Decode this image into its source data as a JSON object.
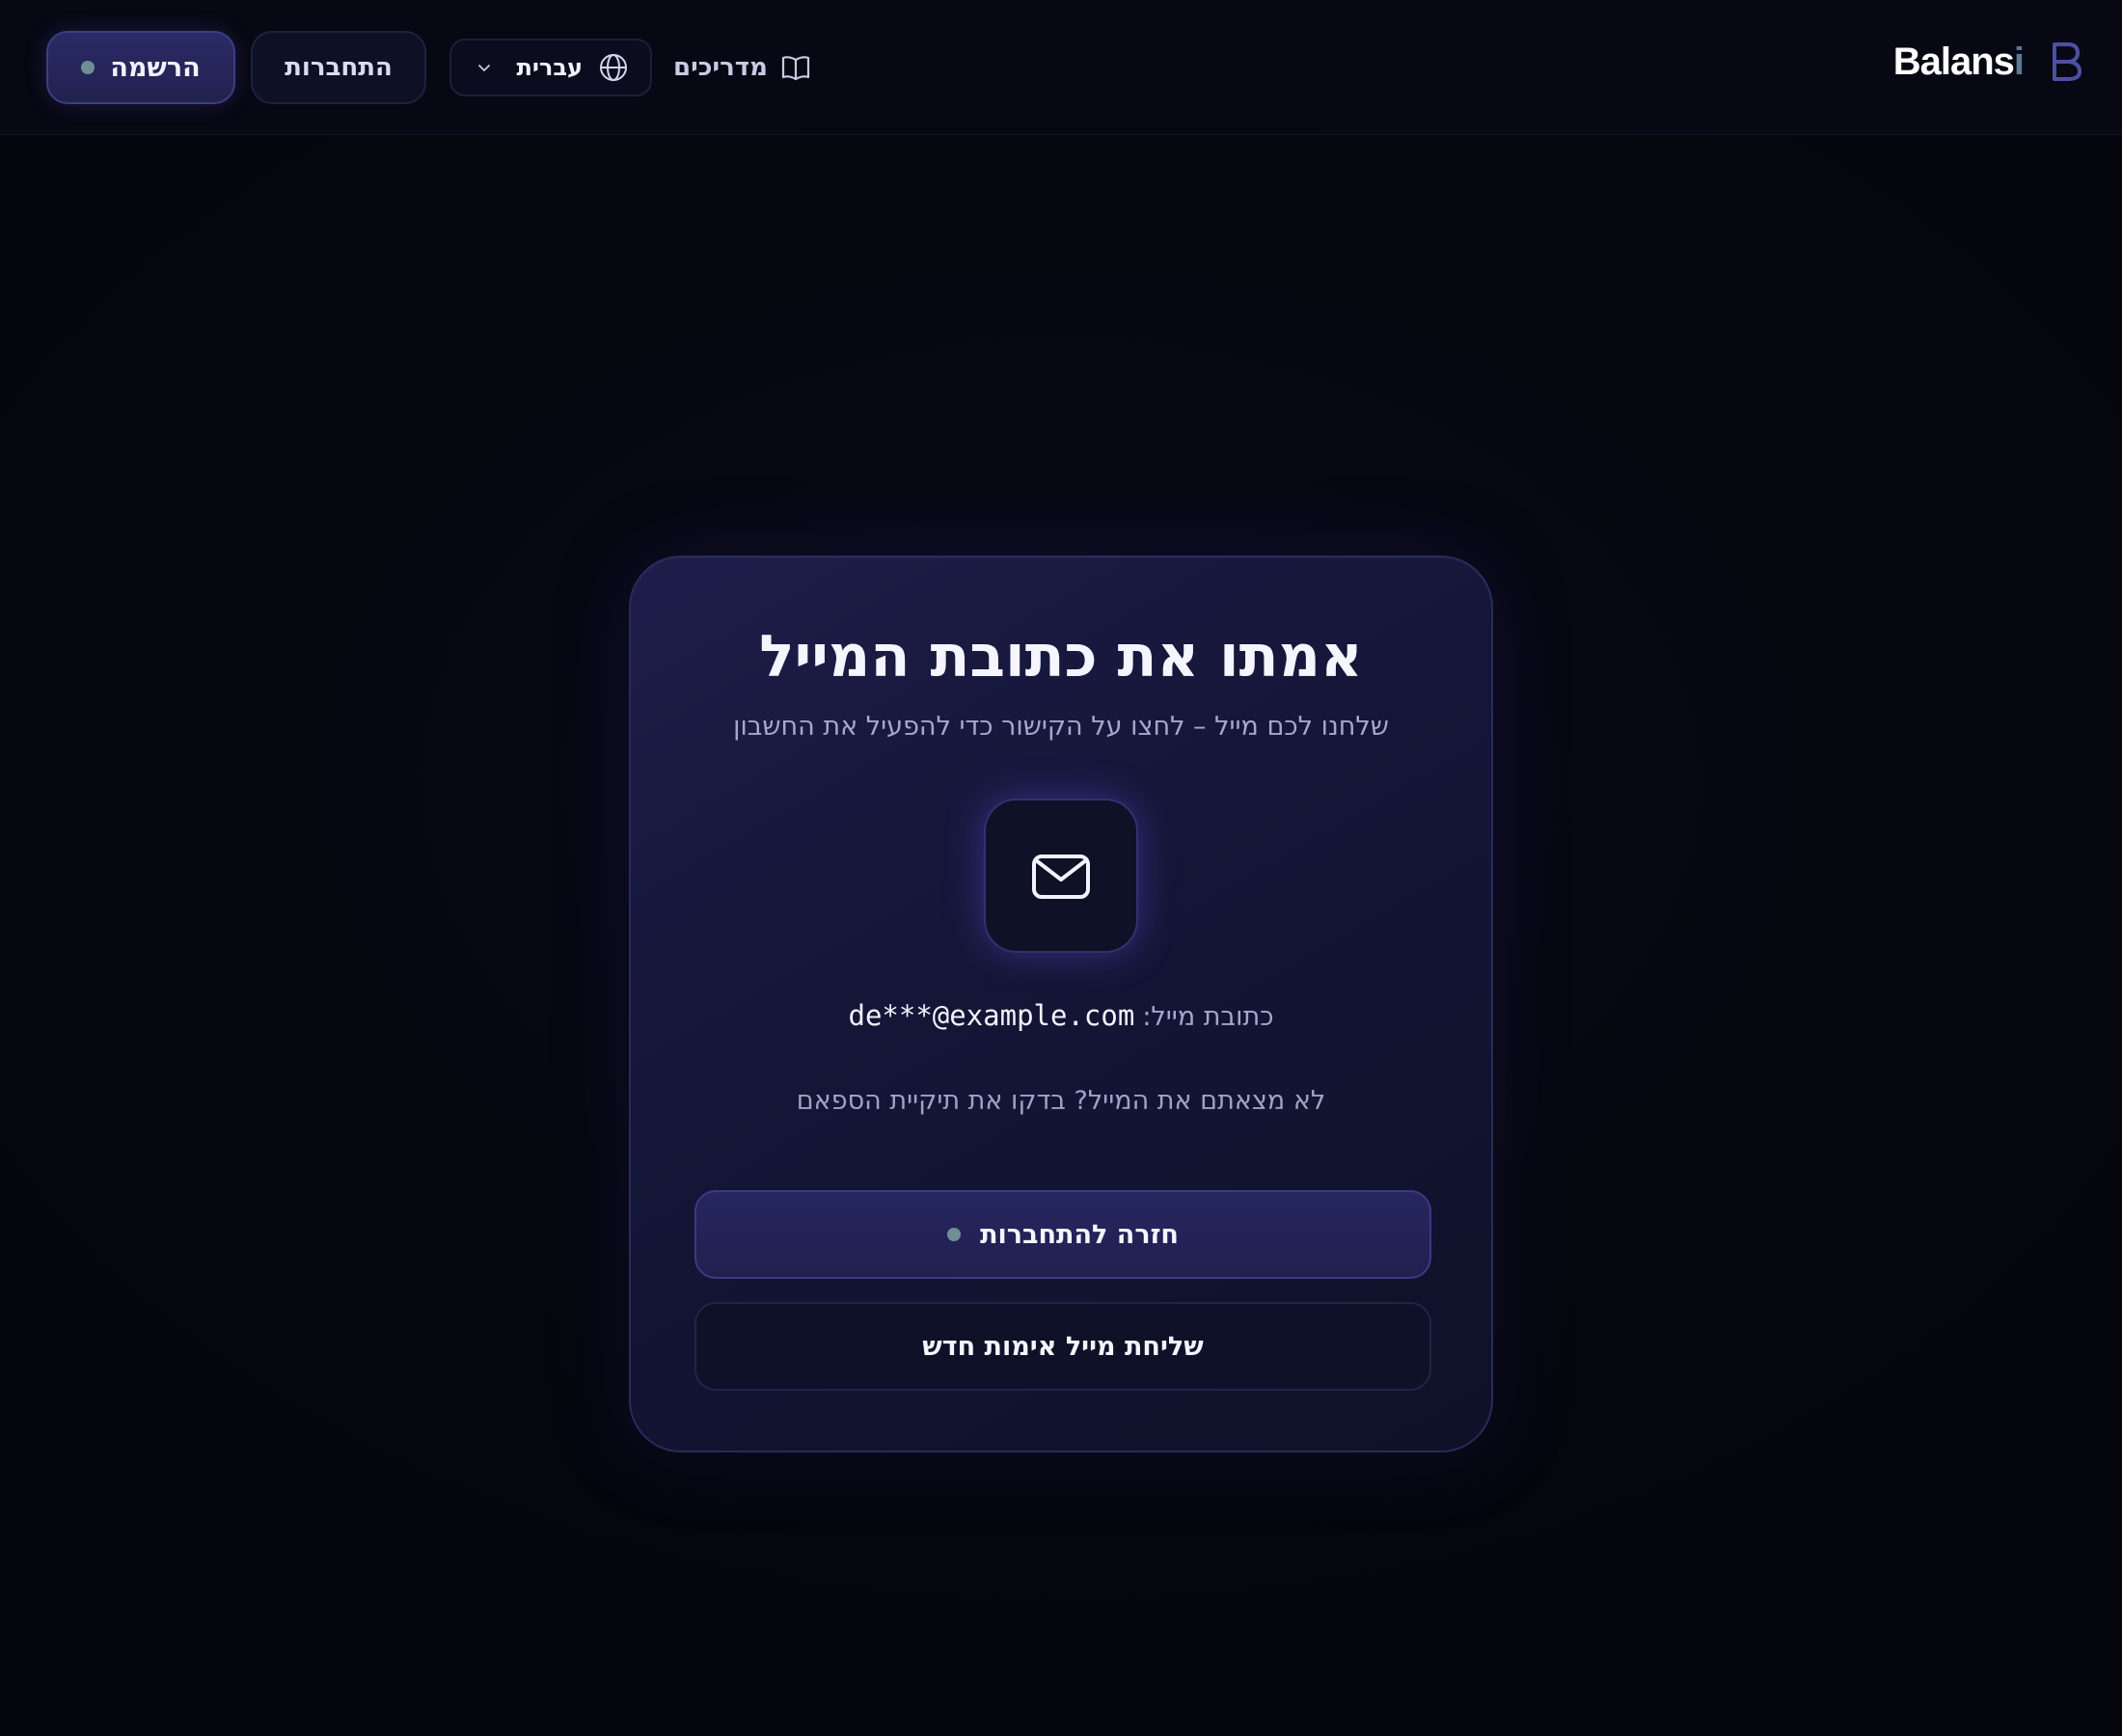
{
  "header": {
    "logo": {
      "text_main": "Balans",
      "text_accent": "i",
      "mark_icon": "b-logo-icon"
    },
    "guides_label": "מדריכים",
    "guides_icon": "book-icon",
    "language": {
      "selected": "עברית",
      "icon": "globe-icon"
    },
    "login_label": "התחברות",
    "signup_label": "הרשמה"
  },
  "card": {
    "title": "אמתו את כתובת המייל",
    "subtitle": "שלחנו לכם מייל – לחצו על הקישור כדי להפעיל את החשבון",
    "icon": "mail-icon",
    "email_label": "כתובת מייל:",
    "email_value": "de***@example.com",
    "spam_note": "לא מצאתם את המייל? בדקו את תיקיית הספאם",
    "back_button": "חזרה להתחברות",
    "resend_button": "שליחת מייל אימות חדש"
  },
  "colors": {
    "background": "#05060f",
    "card": "#151638",
    "accent_button": "#242458",
    "dot": "#6f8f95",
    "logo_accent": "#5f7891"
  }
}
